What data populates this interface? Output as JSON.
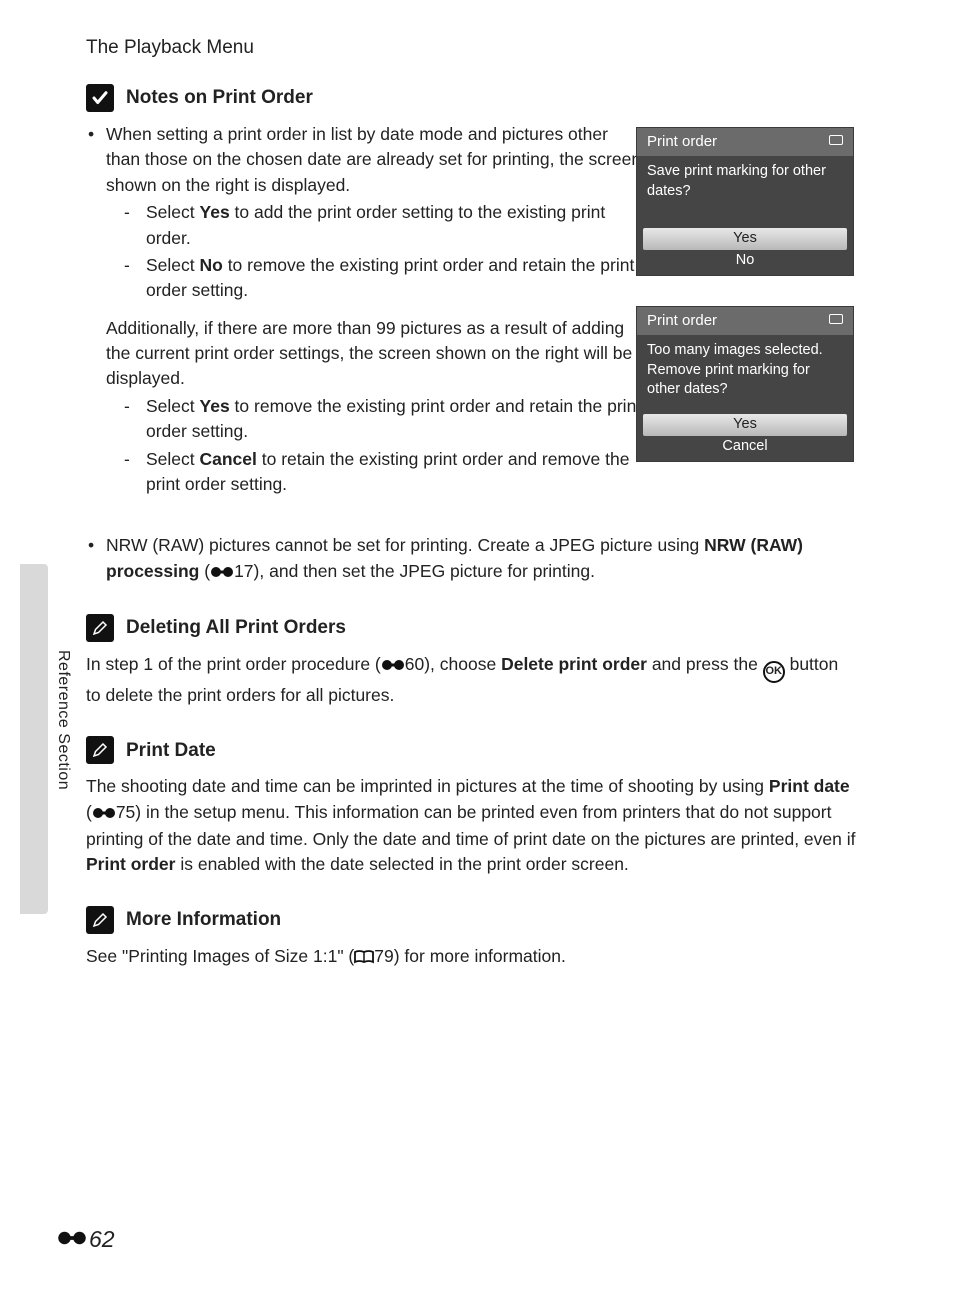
{
  "header": {
    "title": "The Playback Menu"
  },
  "side_label": "Reference Section",
  "section1": {
    "title": "Notes on Print Order",
    "bullet1_text": "When setting a print order in list by date mode and pictures other than those on the chosen date are already set for printing, the screen shown on the right is displayed.",
    "dash1a_pre": "Select ",
    "dash1a_bold": "Yes",
    "dash1a_post": " to add the print order setting to the existing print order.",
    "dash1b_pre": "Select ",
    "dash1b_bold": "No",
    "dash1b_post": " to remove the existing print order and retain the print order setting.",
    "para2": "Additionally, if there are more than 99 pictures as a result of adding the current print order settings, the screen shown on the right will be displayed.",
    "dash2a_pre": "Select ",
    "dash2a_bold": "Yes",
    "dash2a_post": " to remove the existing print order and retain the print order setting.",
    "dash2b_pre": "Select ",
    "dash2b_bold": "Cancel",
    "dash2b_post": " to retain the existing print order and remove the print order setting.",
    "bullet3_pre": "NRW (RAW) pictures cannot be set for printing. Create a JPEG picture using ",
    "bullet3_bold": "NRW (RAW) processing",
    "bullet3_mid": " (",
    "bullet3_ref": "17",
    "bullet3_post": "), and then set the JPEG picture for printing."
  },
  "screenshot1": {
    "title": "Print order",
    "message": "Save print marking for other dates?",
    "opt1": "Yes",
    "opt2": "No"
  },
  "screenshot2": {
    "title": "Print order",
    "message": "Too many images selected. Remove print marking for other dates?",
    "opt1": "Yes",
    "opt2": "Cancel"
  },
  "section2": {
    "title": "Deleting All Print Orders",
    "text_pre": "In step 1 of the print order procedure (",
    "ref": "60",
    "text_mid": "), choose ",
    "bold": "Delete print order",
    "text_mid2": " and press the ",
    "ok": "OK",
    "text_post": " button to delete the print orders for all pictures."
  },
  "section3": {
    "title": "Print Date",
    "text_pre": "The shooting date and time can be imprinted in pictures at the time of shooting by using ",
    "bold1": "Print date",
    "text_mid1": " (",
    "ref": "75",
    "text_mid2": ") in the setup menu. This information can be printed even from printers that do not support printing of the date and time. Only the date and time of print date on the pictures are printed, even if ",
    "bold2": "Print order",
    "text_post": " is enabled with the date selected in the print order screen."
  },
  "section4": {
    "title": "More Information",
    "text_pre": "See \"Printing Images of Size 1:1\" (",
    "book_ref": "79",
    "text_post": ") for more information."
  },
  "footer": {
    "page": "62"
  }
}
